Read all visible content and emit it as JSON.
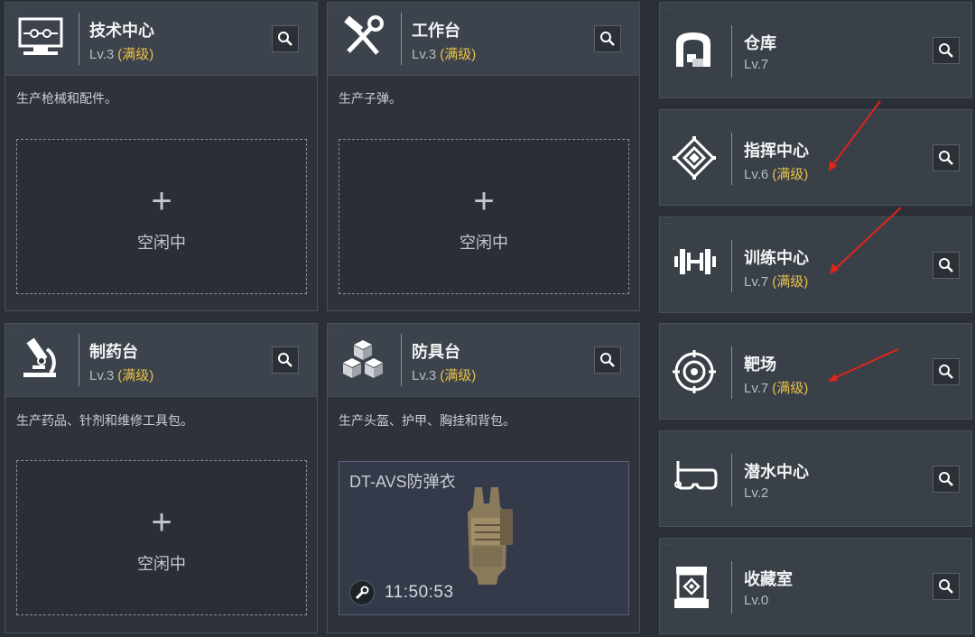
{
  "level_maxed_label": "(满级)",
  "idle_label": "空闲中",
  "plus_label": "+",
  "accent_gold": "#e8c24a",
  "annotation_red": "#e0241b",
  "stations": {
    "tech": {
      "title": "技术中心",
      "level": "Lv.3",
      "desc": "生产枪械和配件。",
      "icon": "computer-icon",
      "slot": "idle"
    },
    "workbench": {
      "title": "工作台",
      "level": "Lv.3",
      "desc": "生产子弹。",
      "icon": "hammer-wrench-icon",
      "slot": "idle"
    },
    "pharmacy": {
      "title": "制药台",
      "level": "Lv.3",
      "desc": "生产药品、针剂和维修工具包。",
      "icon": "microscope-icon",
      "slot": "idle"
    },
    "armor": {
      "title": "防具台",
      "level": "Lv.3",
      "desc": "生产头盔、护甲、胸挂和背包。",
      "icon": "boxes-icon",
      "slot": "crafting",
      "crafting": {
        "item": "DT-AVS防弹衣",
        "timer": "11:50:53",
        "item_icon": "plate-carrier-icon"
      }
    }
  },
  "facilities": [
    {
      "title": "仓库",
      "level": "Lv.7",
      "maxed": false,
      "icon": "warehouse-icon"
    },
    {
      "title": "指挥中心",
      "level": "Lv.6",
      "maxed": true,
      "icon": "command-emblem-icon"
    },
    {
      "title": "训练中心",
      "level": "Lv.7",
      "maxed": true,
      "icon": "dumbbell-icon"
    },
    {
      "title": "靶场",
      "level": "Lv.7",
      "maxed": true,
      "icon": "target-icon"
    },
    {
      "title": "潜水中心",
      "level": "Lv.2",
      "maxed": false,
      "icon": "diving-mask-icon"
    },
    {
      "title": "收藏室",
      "level": "Lv.0",
      "maxed": false,
      "icon": "display-case-icon"
    }
  ]
}
